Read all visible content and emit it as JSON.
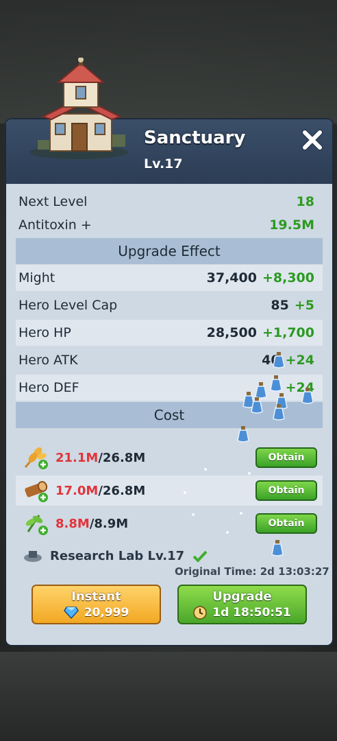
{
  "header": {
    "title": "Sanctuary",
    "level": "Lv.17"
  },
  "info_rows": [
    {
      "label": "Next Level",
      "value": "18"
    },
    {
      "label": "Antitoxin +",
      "value": "19.5M"
    }
  ],
  "upgrade_effect": {
    "heading": "Upgrade Effect",
    "rows": [
      {
        "label": "Might",
        "current": "37,400",
        "bonus": "+8,300"
      },
      {
        "label": "Hero Level Cap",
        "current": "85",
        "bonus": "+5"
      },
      {
        "label": "Hero HP",
        "current": "28,500",
        "bonus": "+1,700"
      },
      {
        "label": "Hero ATK",
        "current": "40",
        "bonus": "+24"
      },
      {
        "label": "Hero DEF",
        "current": "",
        "bonus": "+24"
      }
    ]
  },
  "cost": {
    "heading": "Cost",
    "items": [
      {
        "icon": "wheat-icon",
        "have": "21.1M",
        "need": "/26.8M",
        "button": "Obtain"
      },
      {
        "icon": "wood-log-icon",
        "have": "17.0M",
        "need": "/26.8M",
        "button": "Obtain"
      },
      {
        "icon": "herb-leaf-icon",
        "have": "8.8M",
        "need": "/8.9M",
        "button": "Obtain"
      }
    ],
    "requirement": "Research Lab Lv.17"
  },
  "original_time": "Original Time: 2d 13:03:27",
  "buttons": {
    "instant_label": "Instant",
    "instant_cost": "20,999",
    "upgrade_label": "Upgrade",
    "upgrade_time": "1d 18:50:51"
  },
  "colors": {
    "panel_bg": "#cfd9e3",
    "header_bg": "#3b4f69",
    "section_bg": "#a9bed4",
    "green_text": "#2c9a21",
    "red_text": "#e2343a",
    "instant_btn": "#f2a823",
    "upgrade_btn": "#4aa72a"
  }
}
